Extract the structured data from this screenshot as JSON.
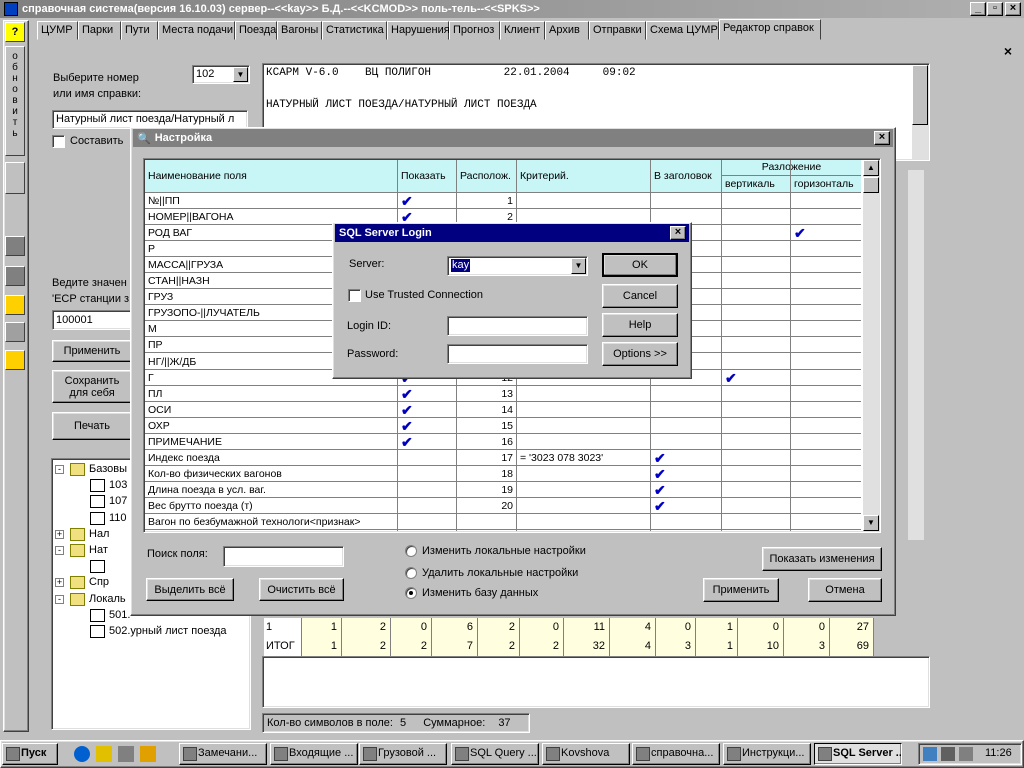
{
  "app": {
    "title": "справочная система(версия 16.10.03) сервер--<<kay>> Б.Д.--<<KCMOD>> поль-тель--<<SPKS>>"
  },
  "tabs": [
    "ЦУМР",
    "Парки",
    "Пути",
    "Места подачи",
    "Поезда",
    "Вагоны",
    "Статистика",
    "Нарушения",
    "Прогноз",
    "Клиент",
    "Архив",
    "Отправки",
    "Схема ЦУМР",
    "Редактор справок"
  ],
  "sidebar": {
    "refresh_text": "обновить",
    "help": "?"
  },
  "left": {
    "choose_label1": "Выберите номер",
    "choose_label2": "или имя справки:",
    "number": "102",
    "report_name": "Натурный лист поезда/Натурный л",
    "compose": "Составить",
    "enter_label": "Ведите значен",
    "esr_label": "'ЕСР станции з",
    "value": "100001",
    "apply": "Применить",
    "save1": "Сохранить",
    "save2": "для себя",
    "print": "Печать"
  },
  "tree": [
    {
      "label": "Базовы",
      "lvl": 0,
      "exp": "-"
    },
    {
      "label": "103",
      "lvl": 1
    },
    {
      "label": "107",
      "lvl": 1
    },
    {
      "label": "110",
      "lvl": 1
    },
    {
      "label": "Нал",
      "lvl": 0,
      "exp": "+"
    },
    {
      "label": "Нат",
      "lvl": 0,
      "exp": "-"
    },
    {
      "label": "",
      "lvl": 1
    },
    {
      "label": "Спр",
      "lvl": 0,
      "exp": "+"
    },
    {
      "label": "Локаль",
      "lvl": 0,
      "exp": "-"
    },
    {
      "label": "501.",
      "lvl": 1
    },
    {
      "label": "502.урный лист поезда",
      "lvl": 1
    }
  ],
  "report": {
    "line1": "КСАРМ V-6.0    ВЦ ПОЛИГОН           22.01.2004     09:02",
    "line2": "НАТУРНЫЙ ЛИСТ ПОЕЗДА/НАТУРНЫЙ ЛИСТ ПОЕЗДА"
  },
  "bottom_table": {
    "row1": [
      "1",
      "1",
      "2",
      "0",
      "6",
      "2",
      "0",
      "11",
      "4",
      "0",
      "1",
      "0",
      "0",
      "27"
    ],
    "row2": [
      "ИТОГ",
      "1",
      "2",
      "2",
      "7",
      "2",
      "2",
      "32",
      "4",
      "3",
      "1",
      "10",
      "3",
      "69"
    ]
  },
  "status": {
    "chars_label": "Кол-во символов в поле:",
    "chars": "5",
    "sum_label": "Суммарное:",
    "sum": "37"
  },
  "settings": {
    "title": "Настройка",
    "headers": {
      "name": "Наименование поля",
      "show": "Показать",
      "pos": "Располож.",
      "crit": "Критерий.",
      "head": "В заголовок",
      "split": "Разложение",
      "vert": "вертикаль",
      "horiz": "горизонталь"
    },
    "rows": [
      {
        "name": "№||ПП",
        "show": true,
        "pos": "1",
        "crit": "",
        "head": false,
        "v": false,
        "h": false
      },
      {
        "name": "НОМЕР||ВАГОНА",
        "show": true,
        "pos": "2",
        "crit": "",
        "head": false,
        "v": false,
        "h": false
      },
      {
        "name": "РОД ВАГ",
        "show": false,
        "pos": "",
        "crit": "",
        "head": false,
        "v": false,
        "h": true
      },
      {
        "name": "Р",
        "show": false,
        "pos": "",
        "crit": "",
        "head": false,
        "v": false,
        "h": false
      },
      {
        "name": "МАССА||ГРУЗА",
        "show": false,
        "pos": "",
        "crit": "",
        "head": false,
        "v": false,
        "h": false
      },
      {
        "name": "СТАН||НАЗН",
        "show": false,
        "pos": "",
        "crit": "",
        "head": false,
        "v": false,
        "h": false
      },
      {
        "name": "ГРУЗ",
        "show": false,
        "pos": "",
        "crit": "",
        "head": false,
        "v": false,
        "h": false
      },
      {
        "name": "ГРУЗОПО-||ЛУЧАТЕЛЬ",
        "show": false,
        "pos": "",
        "crit": "",
        "head": false,
        "v": false,
        "h": false
      },
      {
        "name": "М",
        "show": false,
        "pos": "",
        "crit": "",
        "head": false,
        "v": false,
        "h": false
      },
      {
        "name": "ПР",
        "show": false,
        "pos": "",
        "crit": "",
        "head": false,
        "v": false,
        "h": false
      },
      {
        "name": "НГ/||Ж/ДБ",
        "show": false,
        "pos": "",
        "crit": "",
        "head": false,
        "v": false,
        "h": false
      },
      {
        "name": "Г",
        "show": true,
        "pos": "12",
        "crit": "",
        "head": false,
        "v": true,
        "h": false
      },
      {
        "name": "ПЛ",
        "show": true,
        "pos": "13",
        "crit": "",
        "head": false,
        "v": false,
        "h": false
      },
      {
        "name": "ОСИ",
        "show": true,
        "pos": "14",
        "crit": "",
        "head": false,
        "v": false,
        "h": false
      },
      {
        "name": "ОХР",
        "show": true,
        "pos": "15",
        "crit": "",
        "head": false,
        "v": false,
        "h": false
      },
      {
        "name": "ПРИМЕЧАНИЕ",
        "show": true,
        "pos": "16",
        "crit": "",
        "head": false,
        "v": false,
        "h": false
      },
      {
        "name": "Индекс поезда",
        "show": false,
        "pos": "17",
        "crit": "= '3023 078 3023'",
        "head": true,
        "v": false,
        "h": false
      },
      {
        "name": "Кол-во физических вагонов",
        "show": false,
        "pos": "18",
        "crit": "",
        "head": true,
        "v": false,
        "h": false
      },
      {
        "name": "Длина поезда в усл. ваг.",
        "show": false,
        "pos": "19",
        "crit": "",
        "head": true,
        "v": false,
        "h": false
      },
      {
        "name": "Вес брутто поезда (т)",
        "show": false,
        "pos": "20",
        "crit": "",
        "head": true,
        "v": false,
        "h": false
      },
      {
        "name": "Вагон по безбумажной технологи<признак>",
        "show": false,
        "pos": "",
        "crit": "",
        "head": false,
        "v": false,
        "h": false
      }
    ],
    "search_label": "Поиск поля:",
    "select_all": "Выделить всё",
    "clear_all": "Очистить всё",
    "radio1": "Изменить локальные настройки",
    "radio2": "Удалить локальные настройки",
    "radio3": "Изменить базу данных",
    "show_changes": "Показать изменения",
    "apply": "Применить",
    "cancel": "Отмена"
  },
  "login": {
    "title": "SQL Server Login",
    "server_label": "Server:",
    "server": "kay",
    "trusted": "Use Trusted Connection",
    "login_label": "Login ID:",
    "login": "",
    "password_label": "Password:",
    "password": "",
    "ok": "OK",
    "cancel": "Cancel",
    "help": "Help",
    "options": "Options >>"
  },
  "taskbar": {
    "start": "Пуск",
    "clock": "11:26",
    "buttons": [
      "Замечани...",
      "Входящие ...",
      "Грузовой ...",
      "SQL Query ...",
      "Kovshova",
      "справочна...",
      "Инструкци...",
      "SQL Server ..."
    ]
  },
  "colors": {
    "title_active": "#000080",
    "title_inactive": "#808080",
    "header_bg": "#c8f5f5",
    "check": "#0000c0"
  }
}
